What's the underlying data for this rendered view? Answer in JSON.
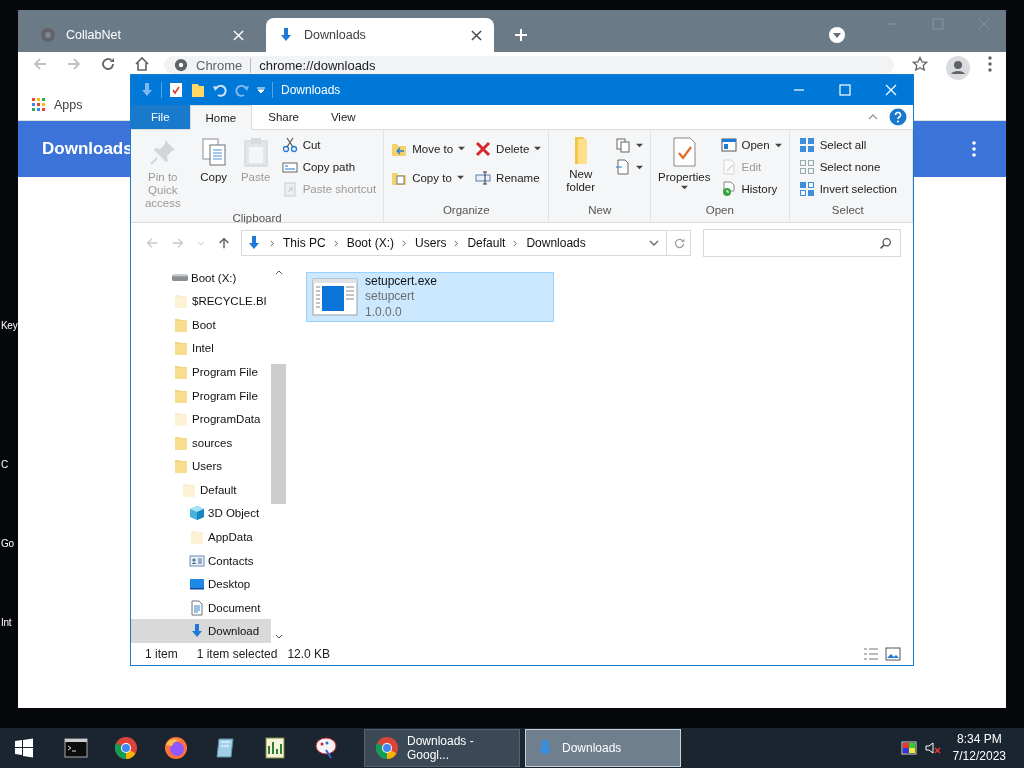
{
  "desktop": {
    "icon_labels": [
      "Key",
      "C",
      "Go",
      "Int"
    ]
  },
  "browser": {
    "tabs": [
      {
        "title": "CollabNet",
        "selected": false
      },
      {
        "title": "Downloads",
        "selected": true
      }
    ],
    "address": {
      "site_label": "Chrome",
      "url": "chrome://downloads"
    },
    "bookmarks": [
      "Apps"
    ],
    "page_title": "Downloads"
  },
  "explorer": {
    "title": "Downloads",
    "ribbon_tabs": [
      {
        "label": "File",
        "kind": "file",
        "selected": false
      },
      {
        "label": "Home",
        "kind": "tab",
        "selected": true
      },
      {
        "label": "Share",
        "kind": "tab",
        "selected": false
      },
      {
        "label": "View",
        "kind": "tab",
        "selected": false
      }
    ],
    "ribbon_groups": [
      {
        "name": "Clipboard",
        "columns": [
          [
            {
              "label": "Pin to Quick access",
              "kind": "large",
              "disabled": true
            }
          ],
          [
            {
              "label": "Copy",
              "kind": "large",
              "disabled": false
            }
          ],
          [
            {
              "label": "Paste",
              "kind": "large",
              "disabled": true
            }
          ],
          [
            {
              "label": "Cut",
              "kind": "small",
              "disabled": false
            },
            {
              "label": "Copy path",
              "kind": "small",
              "disabled": false
            },
            {
              "label": "Paste shortcut",
              "kind": "small",
              "disabled": true
            }
          ]
        ]
      },
      {
        "name": "Organize",
        "columns": [
          [
            {
              "label": "Move to",
              "kind": "small",
              "dropdown": true,
              "disabled": false
            },
            {
              "label": "Copy to",
              "kind": "small",
              "dropdown": true,
              "disabled": false
            }
          ],
          [
            {
              "label": "Delete",
              "kind": "small",
              "dropdown": true,
              "disabled": false
            },
            {
              "label": "Rename",
              "kind": "small",
              "disabled": false
            }
          ]
        ]
      },
      {
        "name": "New",
        "columns": [
          [
            {
              "label": "New folder",
              "kind": "large",
              "disabled": false
            }
          ],
          [
            {
              "kind": "small",
              "dropdown": true,
              "disabled": false
            },
            {
              "kind": "small",
              "dropdown": true,
              "disabled": false
            }
          ]
        ]
      },
      {
        "name": "Open",
        "columns": [
          [
            {
              "label": "Properties",
              "kind": "large",
              "dropdown": true,
              "disabled": false
            }
          ],
          [
            {
              "label": "Open",
              "kind": "small",
              "dropdown": true,
              "disabled": false
            },
            {
              "label": "Edit",
              "kind": "small",
              "disabled": true
            },
            {
              "label": "History",
              "kind": "small",
              "disabled": false
            }
          ]
        ]
      },
      {
        "name": "Select",
        "columns": [
          [
            {
              "label": "Select all",
              "kind": "small",
              "disabled": false
            },
            {
              "label": "Select none",
              "kind": "small",
              "disabled": false
            },
            {
              "label": "Invert selection",
              "kind": "small",
              "disabled": false
            }
          ]
        ]
      }
    ],
    "breadcrumb": [
      "This PC",
      "Boot (X:)",
      "Users",
      "Default",
      "Downloads"
    ],
    "tree": [
      {
        "label": "Boot (X:)",
        "kind": "drive",
        "hidden": false,
        "selected": false,
        "children": [
          {
            "label": "$RECYCLE.BI",
            "kind": "folder",
            "hidden": true,
            "selected": false
          },
          {
            "label": "Boot",
            "kind": "folder",
            "hidden": false,
            "selected": false
          },
          {
            "label": "Intel",
            "kind": "folder",
            "hidden": false,
            "selected": false
          },
          {
            "label": "Program File",
            "kind": "folder",
            "hidden": false,
            "selected": false
          },
          {
            "label": "Program File",
            "kind": "folder",
            "hidden": false,
            "selected": false
          },
          {
            "label": "ProgramData",
            "kind": "folder",
            "hidden": true,
            "selected": false
          },
          {
            "label": "sources",
            "kind": "folder",
            "hidden": false,
            "selected": false
          },
          {
            "label": "Users",
            "kind": "folder",
            "hidden": false,
            "selected": false,
            "children": [
              {
                "label": "Default",
                "kind": "folder",
                "hidden": true,
                "selected": false,
                "children": [
                  {
                    "label": "3D Object",
                    "kind": "cube",
                    "hidden": false,
                    "selected": false
                  },
                  {
                    "label": "AppData",
                    "kind": "folder",
                    "hidden": true,
                    "selected": false
                  },
                  {
                    "label": "Contacts",
                    "kind": "contacts",
                    "hidden": false,
                    "selected": false
                  },
                  {
                    "label": "Desktop",
                    "kind": "desktop",
                    "hidden": false,
                    "selected": false
                  },
                  {
                    "label": "Document",
                    "kind": "document",
                    "hidden": false,
                    "selected": false
                  },
                  {
                    "label": "Download",
                    "kind": "download",
                    "hidden": false,
                    "selected": true
                  }
                ]
              }
            ]
          }
        ]
      }
    ],
    "files": [
      {
        "name": "setupcert.exe",
        "description": "setupcert",
        "version": "1.0.0.0",
        "selected": true
      }
    ],
    "status": {
      "count": "1 item",
      "selection": "1 item selected",
      "size": "12.0 KB"
    }
  },
  "taskbar": {
    "tasks": [
      {
        "label": "Downloads - Googl...",
        "selected": false
      },
      {
        "label": "Downloads",
        "selected": true
      }
    ],
    "time": "8:34 PM",
    "date": "7/12/2023"
  }
}
